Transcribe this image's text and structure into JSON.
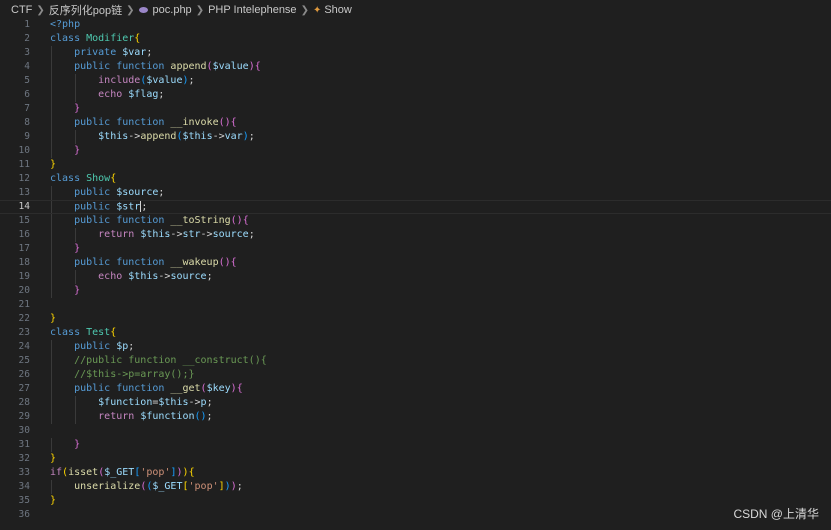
{
  "breadcrumb": {
    "items": [
      "CTF",
      "反序列化pop链",
      "poc.php",
      "PHP Intelephense",
      "Show"
    ]
  },
  "watermark": "CSDN @上清华",
  "editor": {
    "active_line": 14,
    "lines": [
      {
        "n": "1",
        "t": [
          [
            "tag",
            "<?php"
          ]
        ]
      },
      {
        "n": "2",
        "t": [
          [
            "kw",
            "class "
          ],
          [
            "cls",
            "Modifier"
          ],
          [
            "b1",
            "{"
          ]
        ]
      },
      {
        "n": "3",
        "t": [
          [
            "kw",
            "    private "
          ],
          [
            "var",
            "$var"
          ],
          [
            "plain",
            ";"
          ]
        ]
      },
      {
        "n": "4",
        "t": [
          [
            "kw",
            "    public function "
          ],
          [
            "fn",
            "append"
          ],
          [
            "b2",
            "("
          ],
          [
            "var",
            "$value"
          ],
          [
            "b2",
            ")"
          ],
          [
            "b2",
            "{"
          ]
        ]
      },
      {
        "n": "5",
        "t": [
          [
            "ctl",
            "        include"
          ],
          [
            "b3",
            "("
          ],
          [
            "var",
            "$value"
          ],
          [
            "b3",
            ")"
          ],
          [
            "plain",
            ";"
          ]
        ]
      },
      {
        "n": "6",
        "t": [
          [
            "ctl",
            "        echo "
          ],
          [
            "var",
            "$flag"
          ],
          [
            "plain",
            ";"
          ]
        ]
      },
      {
        "n": "7",
        "t": [
          [
            "b2",
            "    }"
          ]
        ]
      },
      {
        "n": "8",
        "t": [
          [
            "kw",
            "    public function "
          ],
          [
            "fn",
            "__invoke"
          ],
          [
            "b2",
            "()"
          ],
          [
            "b2",
            "{"
          ]
        ]
      },
      {
        "n": "9",
        "t": [
          [
            "var",
            "        $this"
          ],
          [
            "plain",
            "->"
          ],
          [
            "fn",
            "append"
          ],
          [
            "b3",
            "("
          ],
          [
            "var",
            "$this"
          ],
          [
            "plain",
            "->"
          ],
          [
            "var",
            "var"
          ],
          [
            "b3",
            ")"
          ],
          [
            "plain",
            ";"
          ]
        ]
      },
      {
        "n": "10",
        "t": [
          [
            "b2",
            "    }"
          ]
        ]
      },
      {
        "n": "11",
        "t": [
          [
            "b1",
            "}"
          ]
        ]
      },
      {
        "n": "12",
        "t": [
          [
            "kw",
            "class "
          ],
          [
            "cls",
            "Show"
          ],
          [
            "b1",
            "{"
          ]
        ]
      },
      {
        "n": "13",
        "t": [
          [
            "kw",
            "    public "
          ],
          [
            "var",
            "$source"
          ],
          [
            "plain",
            ";"
          ]
        ]
      },
      {
        "n": "14",
        "t": [
          [
            "kw",
            "    public "
          ],
          [
            "var",
            "$str"
          ],
          [
            "plain",
            ";"
          ]
        ]
      },
      {
        "n": "15",
        "t": [
          [
            "kw",
            "    public function "
          ],
          [
            "fn",
            "__toString"
          ],
          [
            "b2",
            "()"
          ],
          [
            "b2",
            "{"
          ]
        ]
      },
      {
        "n": "16",
        "t": [
          [
            "ctl",
            "        return "
          ],
          [
            "var",
            "$this"
          ],
          [
            "plain",
            "->"
          ],
          [
            "var",
            "str"
          ],
          [
            "plain",
            "->"
          ],
          [
            "var",
            "source"
          ],
          [
            "plain",
            ";"
          ]
        ]
      },
      {
        "n": "17",
        "t": [
          [
            "b2",
            "    }"
          ]
        ]
      },
      {
        "n": "18",
        "t": [
          [
            "kw",
            "    public function "
          ],
          [
            "fn",
            "__wakeup"
          ],
          [
            "b2",
            "()"
          ],
          [
            "b2",
            "{"
          ]
        ]
      },
      {
        "n": "19",
        "t": [
          [
            "ctl",
            "        echo "
          ],
          [
            "var",
            "$this"
          ],
          [
            "plain",
            "->"
          ],
          [
            "var",
            "source"
          ],
          [
            "plain",
            ";"
          ]
        ]
      },
      {
        "n": "20",
        "t": [
          [
            "b2",
            "    }"
          ]
        ]
      },
      {
        "n": "21",
        "t": []
      },
      {
        "n": "22",
        "t": [
          [
            "b1",
            "}"
          ]
        ]
      },
      {
        "n": "23",
        "t": [
          [
            "kw",
            "class "
          ],
          [
            "cls",
            "Test"
          ],
          [
            "b1",
            "{"
          ]
        ]
      },
      {
        "n": "24",
        "t": [
          [
            "kw",
            "    public "
          ],
          [
            "var",
            "$p"
          ],
          [
            "plain",
            ";"
          ]
        ]
      },
      {
        "n": "25",
        "t": [
          [
            "cmt",
            "    //public function __construct(){"
          ]
        ]
      },
      {
        "n": "26",
        "t": [
          [
            "cmt",
            "    //$this->p=array();}"
          ]
        ]
      },
      {
        "n": "27",
        "t": [
          [
            "kw",
            "    public function "
          ],
          [
            "fn",
            "__get"
          ],
          [
            "b2",
            "("
          ],
          [
            "var",
            "$key"
          ],
          [
            "b2",
            ")"
          ],
          [
            "b2",
            "{"
          ]
        ]
      },
      {
        "n": "28",
        "t": [
          [
            "var",
            "        $function"
          ],
          [
            "plain",
            "="
          ],
          [
            "var",
            "$this"
          ],
          [
            "plain",
            "->"
          ],
          [
            "var",
            "p"
          ],
          [
            "plain",
            ";"
          ]
        ]
      },
      {
        "n": "29",
        "t": [
          [
            "ctl",
            "        return "
          ],
          [
            "var",
            "$function"
          ],
          [
            "b3",
            "()"
          ],
          [
            "plain",
            ";"
          ]
        ]
      },
      {
        "n": "30",
        "t": []
      },
      {
        "n": "31",
        "t": [
          [
            "b2",
            "    }"
          ]
        ]
      },
      {
        "n": "32",
        "t": [
          [
            "b1",
            "}"
          ]
        ]
      },
      {
        "n": "33",
        "t": [
          [
            "ctl",
            "if"
          ],
          [
            "b1",
            "("
          ],
          [
            "fn",
            "isset"
          ],
          [
            "b2",
            "("
          ],
          [
            "var",
            "$_GET"
          ],
          [
            "b3",
            "["
          ],
          [
            "str",
            "'pop'"
          ],
          [
            "b3",
            "]"
          ],
          [
            "b2",
            ")"
          ],
          [
            "b1",
            ")"
          ],
          [
            "b1",
            "{"
          ]
        ]
      },
      {
        "n": "34",
        "t": [
          [
            "fn",
            "    unserialize"
          ],
          [
            "b2",
            "("
          ],
          [
            "b3",
            "("
          ],
          [
            "var",
            "$_GET"
          ],
          [
            "b1",
            "["
          ],
          [
            "str",
            "'pop'"
          ],
          [
            "b1",
            "]"
          ],
          [
            "b3",
            ")"
          ],
          [
            "b2",
            ")"
          ],
          [
            "plain",
            ";"
          ]
        ]
      },
      {
        "n": "35",
        "t": [
          [
            "b1",
            "}"
          ]
        ]
      },
      {
        "n": "36",
        "t": []
      }
    ]
  }
}
